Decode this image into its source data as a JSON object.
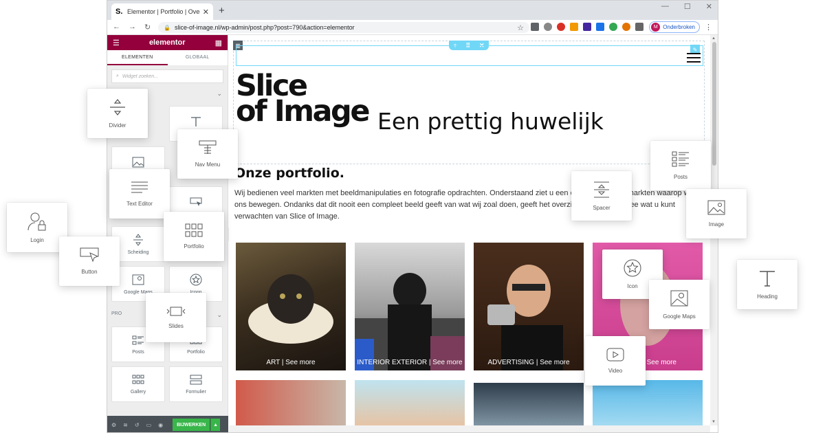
{
  "browser": {
    "tab_title": "Elementor | Portfolio | Overzicht",
    "url": "slice-of-image.nl/wp-admin/post.php?post=790&action=elementor",
    "profile_initial": "M",
    "profile_label": "Onderbroken"
  },
  "panel": {
    "brand": "elementor",
    "tab_elements": "ELEMENTEN",
    "tab_global": "GLOBAAL",
    "search_placeholder": "Widget zoeken...",
    "pro_label": "PRO",
    "update_label": "BIJWERKEN",
    "tiles": {
      "scheiding": "Scheiding",
      "google_maps": "Google Maps",
      "icoon": "Icoon",
      "posts": "Posts",
      "portfolio": "Portfolio",
      "gallery": "Gallery",
      "formulier": "Formulier"
    }
  },
  "page": {
    "logo_line1": "Slice",
    "logo_line2": "of Image",
    "hero_heading": "Een prettig huwelijk",
    "portfolio_title": "Onze portfolio.",
    "intro_text": "Wij bedienen veel markten met beeldmanipulaties en fotografie opdrachten. Onderstaand ziet u een overzicht van de markten waarop wij ons bewegen. Ondanks dat dit nooit een compleet beeld geeft van wat wij zoal doen, geeft het overzicht u een goed idee wat u kunt verwachten van Slice of Image.",
    "captions": [
      "ART | See more",
      "INTERIOR EXTERIOR | See more",
      "ADVERTISING | See more",
      "See more"
    ]
  },
  "floating_widgets": {
    "divider": "Divider",
    "nav_menu": "Nav Menu",
    "text_editor": "Text Editor",
    "portfolio": "Portfolio",
    "login": "Login",
    "button": "Button",
    "slides": "Slides",
    "spacer": "Spacer",
    "posts": "Posts",
    "image": "Image",
    "icon": "Icon",
    "google_maps": "Google Maps",
    "heading": "Heading",
    "video": "Video"
  },
  "colors": {
    "elementor_brand": "#93003c",
    "update_green": "#39b54a",
    "edit_blue": "#71d7f7"
  }
}
